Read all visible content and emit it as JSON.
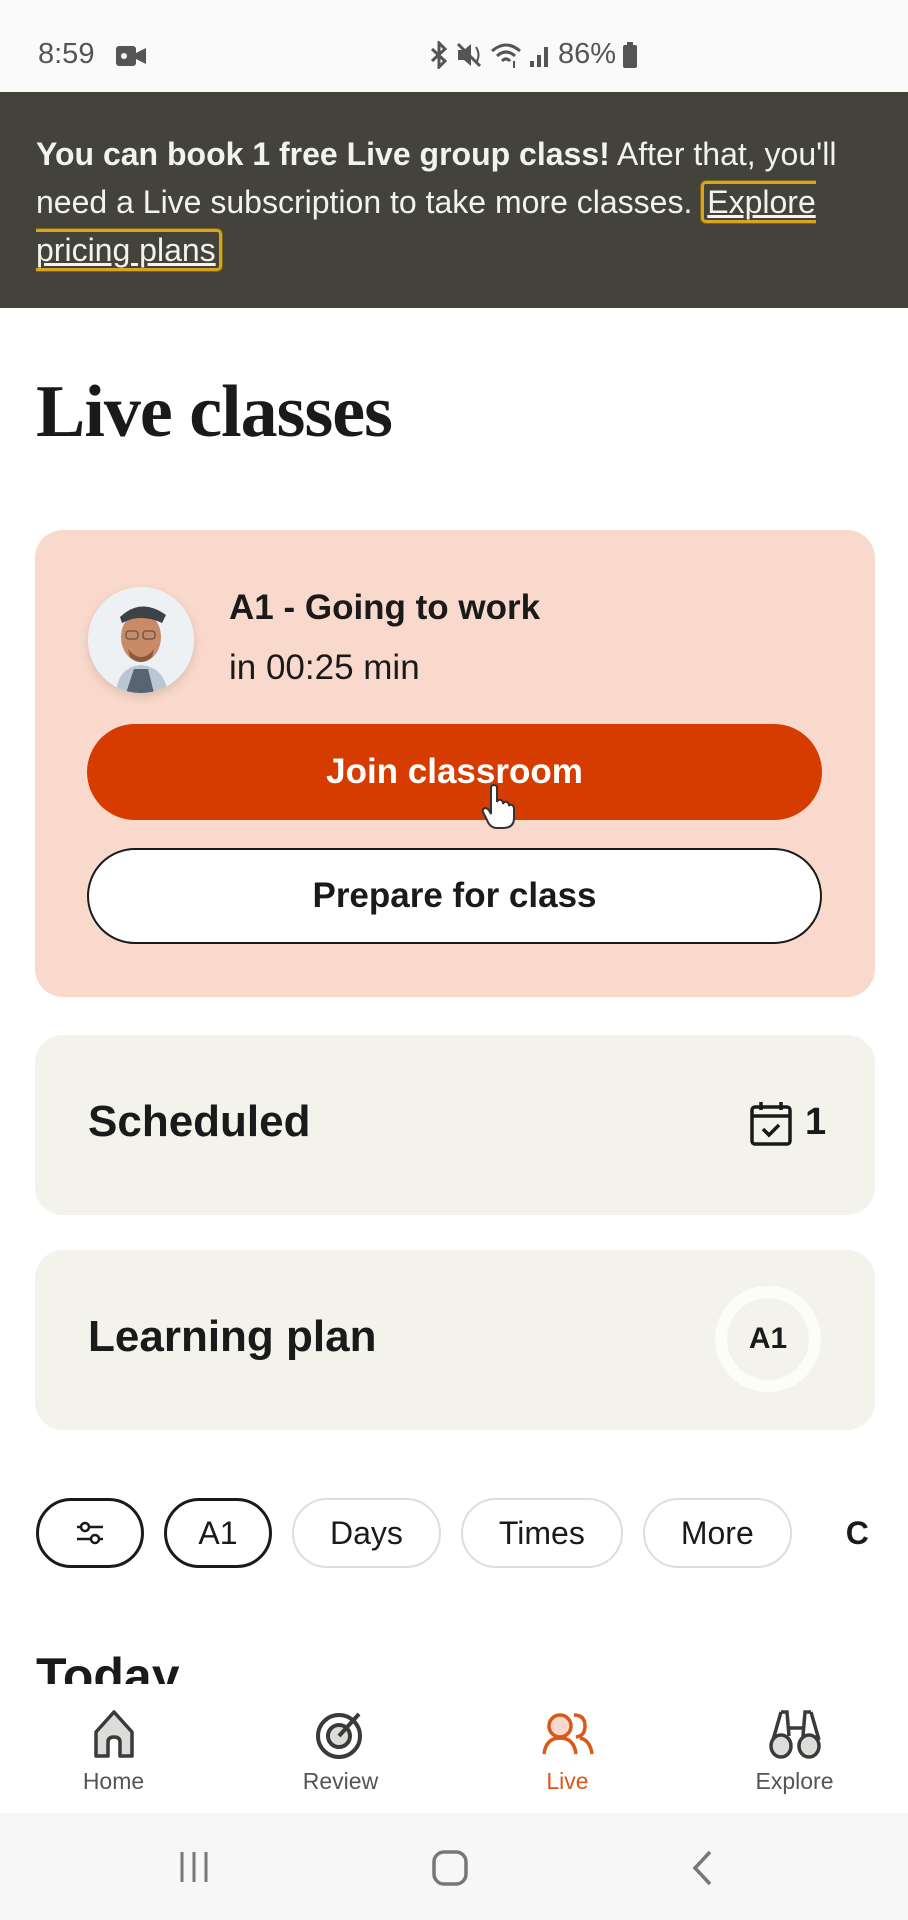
{
  "status_bar": {
    "time": "8:59",
    "battery": "86%",
    "icons": [
      "video-camera-icon",
      "bluetooth-icon",
      "mute-icon",
      "wifi-icon",
      "signal-icon",
      "battery-icon"
    ]
  },
  "banner": {
    "bold_text": "You can book 1 free Live group class!",
    "text": " After that, you'll need a Live subscription to take more classes. ",
    "link_label": "Explore pricing plans"
  },
  "page_title": "Live classes",
  "upcoming_class": {
    "title": "A1 - Going to work",
    "countdown": "in 00:25 min",
    "join_label": "Join classroom",
    "prepare_label": "Prepare for class",
    "accent_color": "#d63c00",
    "card_color": "#f9d9cb"
  },
  "scheduled": {
    "label": "Scheduled",
    "count": "1"
  },
  "learning_plan": {
    "label": "Learning plan",
    "level": "A1"
  },
  "filters": {
    "chips": [
      {
        "label": "A1",
        "active": true
      },
      {
        "label": "Days",
        "active": false
      },
      {
        "label": "Times",
        "active": false
      },
      {
        "label": "More",
        "active": false
      }
    ],
    "truncated_next": "C"
  },
  "section_heading": "Today",
  "bottom_nav": {
    "items": [
      {
        "label": "Home",
        "icon": "home-icon",
        "active": false
      },
      {
        "label": "Review",
        "icon": "target-icon",
        "active": false
      },
      {
        "label": "Live",
        "icon": "people-icon",
        "active": true
      },
      {
        "label": "Explore",
        "icon": "binoculars-icon",
        "active": false
      }
    ],
    "active_color": "#d9581a"
  }
}
